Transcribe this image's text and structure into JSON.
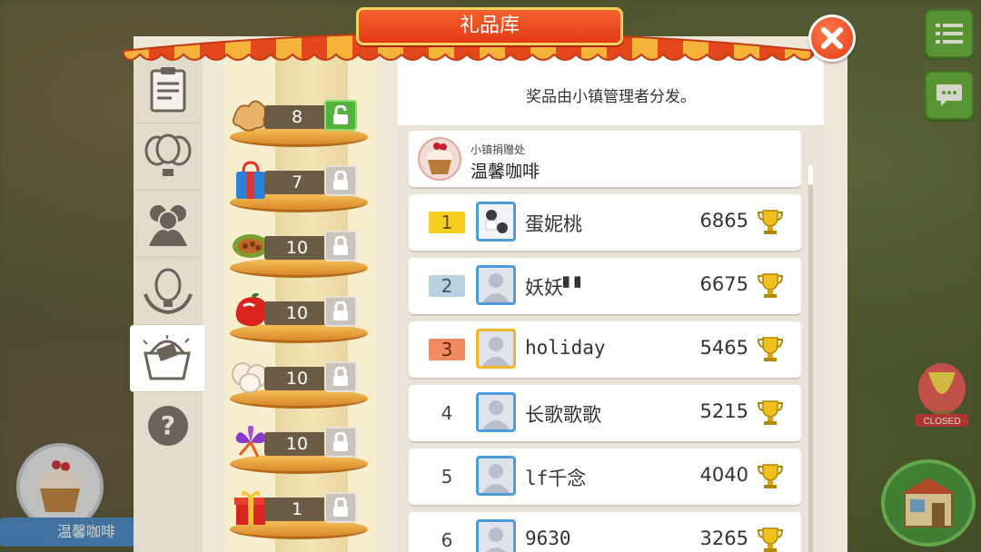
{
  "dialog": {
    "title": "礼品库",
    "notice": "奖品由小镇管理者分发。"
  },
  "donor": {
    "label": "小镇捐赠处",
    "name": "温馨咖啡"
  },
  "shelf_items": [
    {
      "icon": "ginger-icon",
      "count": "8",
      "unlocked": true
    },
    {
      "icon": "gift-bag-icon",
      "count": "7",
      "unlocked": false
    },
    {
      "icon": "cocoa-pod-icon",
      "count": "10",
      "unlocked": false
    },
    {
      "icon": "red-pepper-icon",
      "count": "10",
      "unlocked": false
    },
    {
      "icon": "eggs-icon",
      "count": "10",
      "unlocked": false
    },
    {
      "icon": "saffron-flower-icon",
      "count": "10",
      "unlocked": false
    },
    {
      "icon": "gift-box-icon",
      "count": "1",
      "unlocked": false
    }
  ],
  "rankings": [
    {
      "rank": "1",
      "name": "蛋妮桃",
      "score": "6865",
      "medal": "gold"
    },
    {
      "rank": "2",
      "name": "妖妖▘▘",
      "score": "6675",
      "medal": "silver"
    },
    {
      "rank": "3",
      "name": "holiday",
      "score": "5465",
      "medal": "bronze"
    },
    {
      "rank": "4",
      "name": "长歌歌歌",
      "score": "5215",
      "medal": ""
    },
    {
      "rank": "5",
      "name": "lf千念",
      "score": "4040",
      "medal": ""
    },
    {
      "rank": "6",
      "name": "9630",
      "score": "3265",
      "medal": ""
    }
  ],
  "side_tabs": [
    "notepad-icon",
    "balloons-icon",
    "people-icon",
    "balloon-wreath-icon",
    "gift-basket-icon",
    "help-icon"
  ],
  "profile": {
    "name": "温馨咖啡"
  },
  "hud": {
    "balloon_badge": "CLOSED"
  },
  "colors": {
    "awning_red": "#e4471c",
    "title_plate": "#e43a16",
    "unlock_green": "#51b339",
    "rank_gold": "#f6cf1e",
    "rank_silver": "#b9d2e2",
    "rank_bronze": "#f28a62"
  }
}
